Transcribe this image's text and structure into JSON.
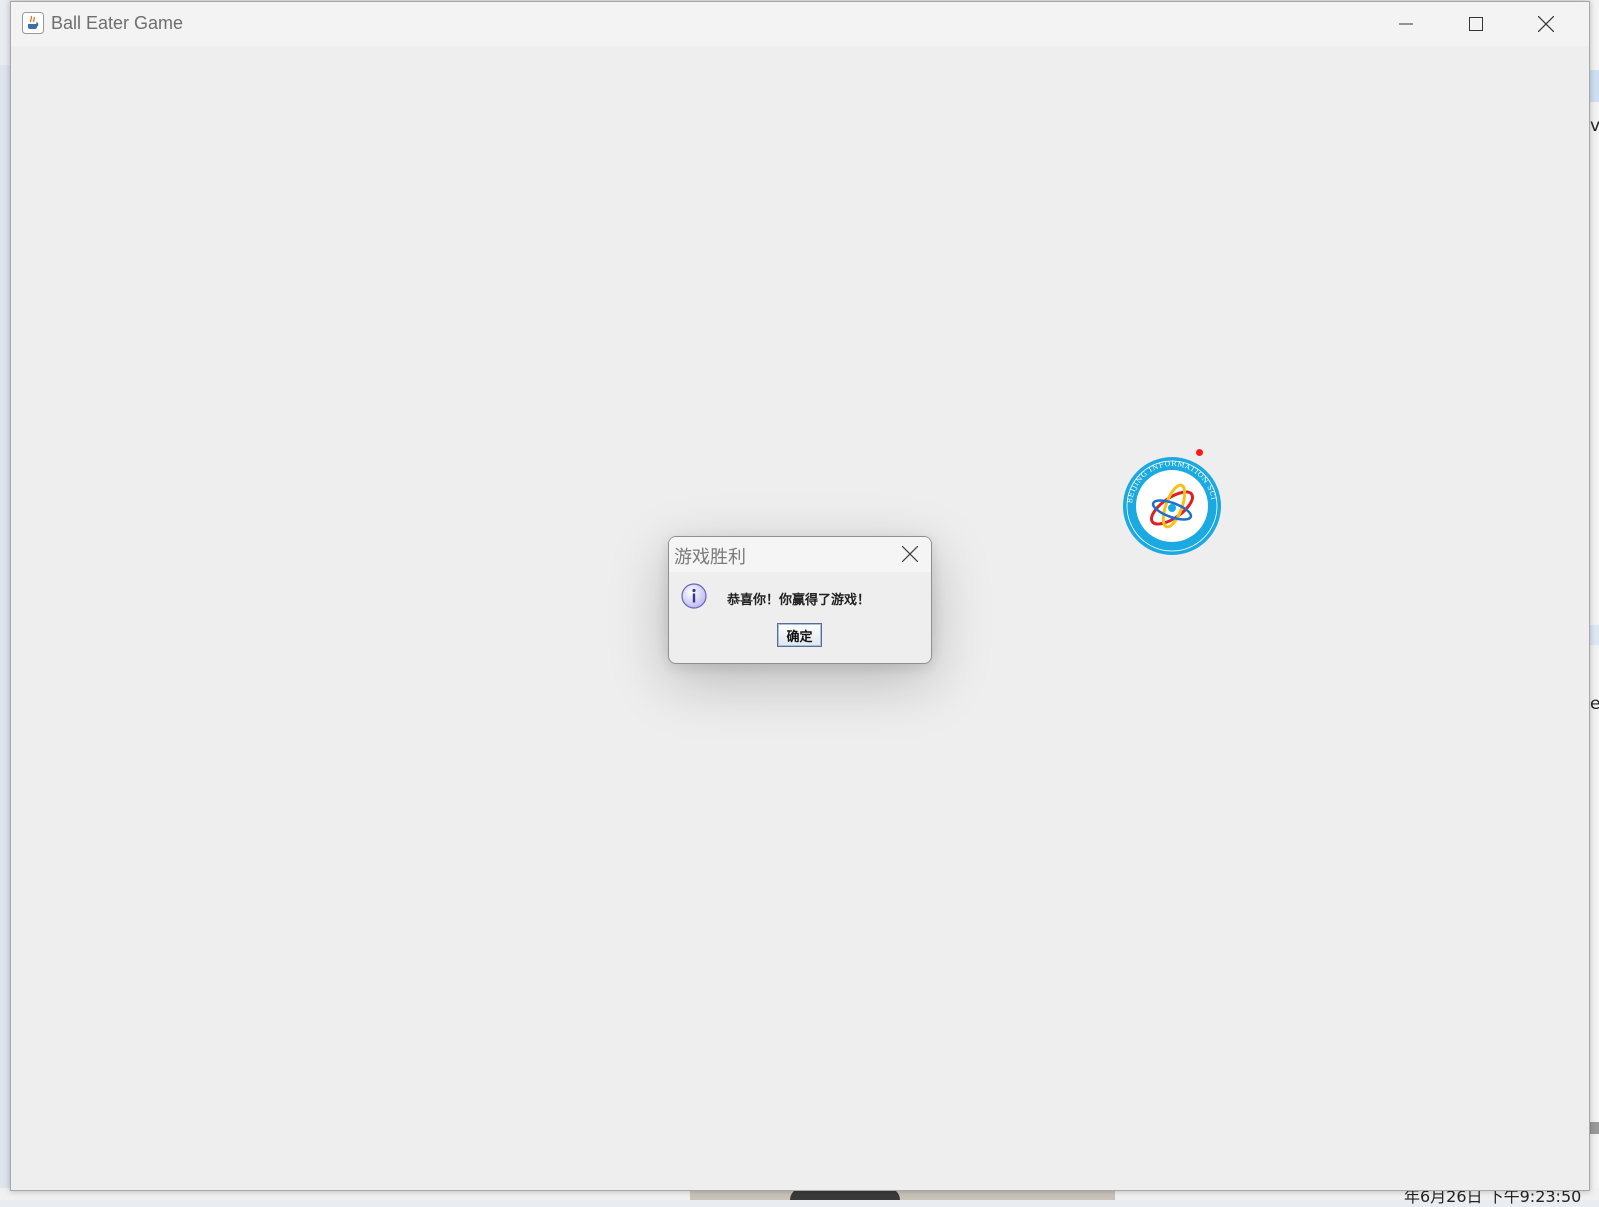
{
  "window": {
    "title": "Ball Eater Game",
    "icons": {
      "app": "java-coffee-icon",
      "minimize": "minimize-icon",
      "maximize": "maximize-icon",
      "close": "close-icon"
    }
  },
  "dialog": {
    "title": "游戏胜利",
    "message": "恭喜你！你赢得了游戏！",
    "ok_label": "确定",
    "icon": "info-icon"
  },
  "game": {
    "player_logo_icon": "university-logo-ball",
    "player_logo_text": "BEIJING INFORMATION SCI UNIVERSITY",
    "food_color": "#ff1a1a"
  },
  "background": {
    "right_edge_letter_1": "v",
    "right_edge_letter_2": "e",
    "taskbar_time": "年6月26日 下午9:23:50"
  },
  "colors": {
    "window_bg": "#eeeeee",
    "dialog_border": "#8f8f8f",
    "logo_blue": "#1aa9e0"
  }
}
